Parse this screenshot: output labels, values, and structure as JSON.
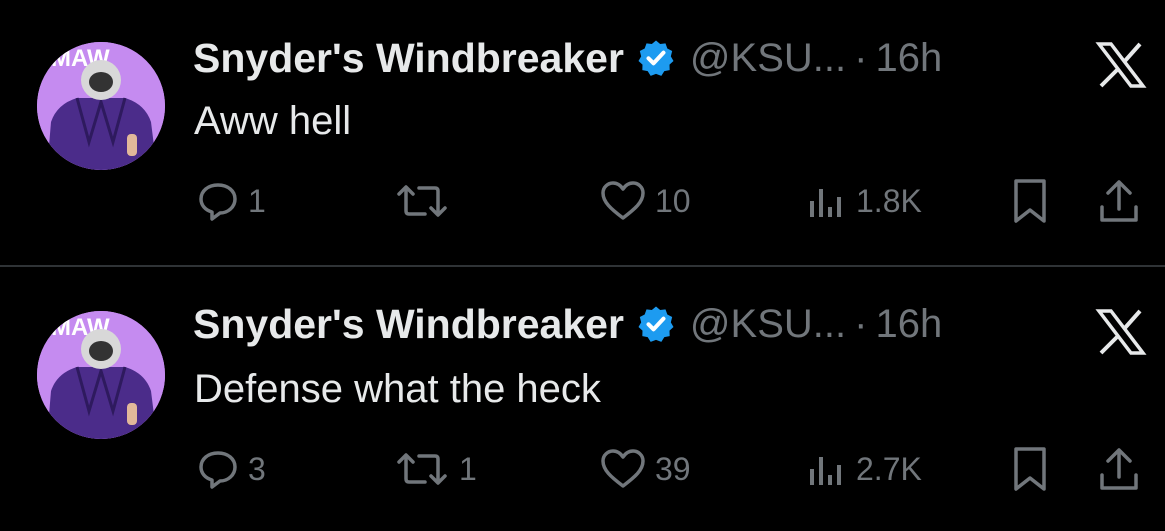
{
  "colors": {
    "background": "#000000",
    "text_primary": "#e7e9ea",
    "text_secondary": "#71767b",
    "verified_blue": "#1d9bf0",
    "divider": "#2f3336",
    "avatar_bg": "#c58bf0"
  },
  "tweets": [
    {
      "avatar_text": "MAW",
      "author_name": "Snyder's Windbreaker",
      "verified_icon": "verified-badge-icon",
      "handle": "@KSU...",
      "separator": "·",
      "time": "16h",
      "logo_icon": "x-logo-icon",
      "text": "Aww hell",
      "actions": {
        "replies": "1",
        "retweets": "",
        "likes": "10",
        "views": "1.8K"
      }
    },
    {
      "avatar_text": "MAW",
      "author_name": "Snyder's Windbreaker",
      "verified_icon": "verified-badge-icon",
      "handle": "@KSU...",
      "separator": "·",
      "time": "16h",
      "logo_icon": "x-logo-icon",
      "text": "Defense what the heck",
      "actions": {
        "replies": "3",
        "retweets": "1",
        "likes": "39",
        "views": "2.7K"
      }
    }
  ]
}
